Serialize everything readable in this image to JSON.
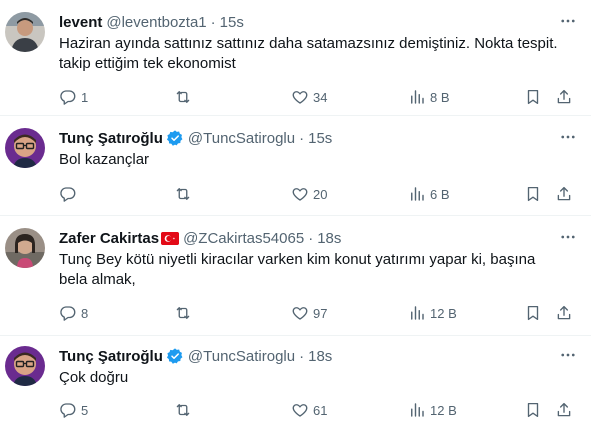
{
  "tweets": [
    {
      "name": "levent",
      "handle": "@leventbozta1",
      "time": "15s",
      "verified": false,
      "lines": [
        "Haziran ayında sattınız sattınız daha satamazsınız demiştiniz. Nokta tespit.",
        "takip ettiğim tek  ekonomist"
      ],
      "replies": "1",
      "retweets": "",
      "likes": "34",
      "views": "8 B"
    },
    {
      "name": "Tunç Şatıroğlu",
      "handle": "@TuncSatiroglu",
      "time": "15s",
      "verified": true,
      "lines": [
        "Bol kazançlar"
      ],
      "replies": "",
      "retweets": "",
      "likes": "20",
      "views": "6 B"
    },
    {
      "name": "Zafer Cakirtas",
      "handle": "@ZCakirtas54065",
      "time": "18s",
      "verified": false,
      "lines": [
        "Tunç Bey kötü niyetli kiracılar varken kim konut yatırımı yapar ki, başına",
        "bela almak,"
      ],
      "replies": "8",
      "retweets": "",
      "likes": "97",
      "views": "12 B"
    },
    {
      "name": "Tunç Şatıroğlu",
      "handle": "@TuncSatiroglu",
      "time": "18s",
      "verified": true,
      "lines": [
        "Çok doğru"
      ],
      "replies": "5",
      "retweets": "",
      "likes": "61",
      "views": "12 B"
    }
  ],
  "separator": "·",
  "icons": {
    "reply": "reply-icon",
    "retweet": "retweet-icon",
    "like": "heart-icon",
    "views": "views-icon",
    "bookmark": "bookmark-icon",
    "share": "share-icon",
    "more": "more-icon",
    "verified": "verified-badge-icon",
    "flag": "turkey-flag-icon"
  },
  "colors": {
    "text": "#0f1419",
    "secondary": "#536471",
    "verified": "#1d9bf0",
    "divider": "#eff3f4"
  }
}
